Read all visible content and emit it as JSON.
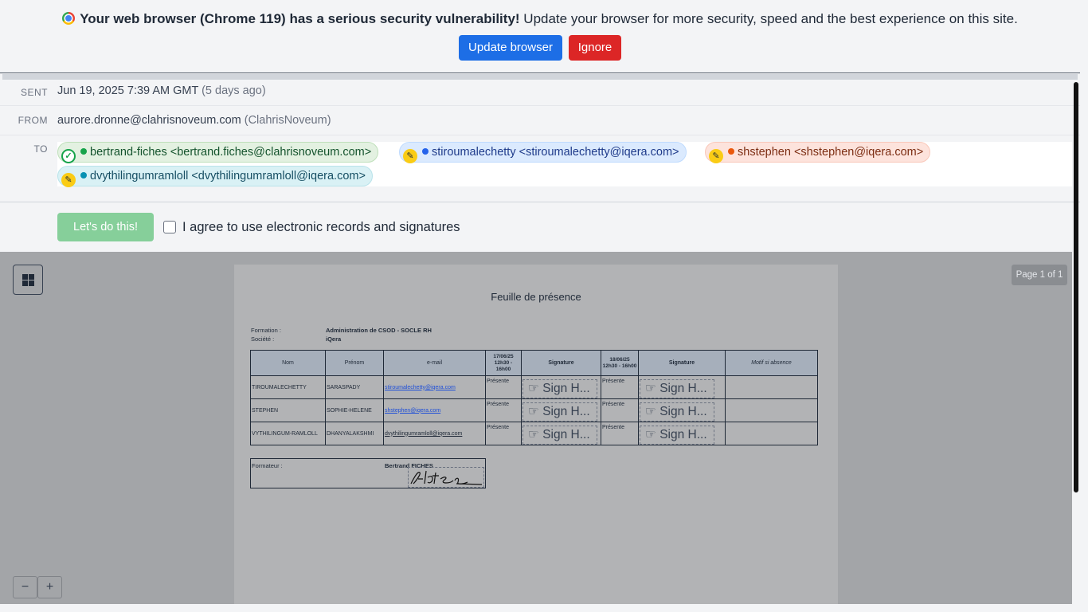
{
  "banner": {
    "icon": "chrome-icon",
    "strong_text": "Your web browser (Chrome 119) has a serious security vulnerability!",
    "text": " Update your browser for more security, speed and the best experience on this site.",
    "update_label": "Update browser",
    "ignore_label": "Ignore",
    "update_color": "#1d6ee6",
    "ignore_color": "#dc2626"
  },
  "message": {
    "sent_label": "SENT",
    "sent_value": "Jun 19, 2025 7:39 AM GMT",
    "sent_relative": "(5 days ago)",
    "from_label": "FROM",
    "from_email": "aurore.dronne@clahrisnoveum.com",
    "from_org": "(ClahrisNoveum)",
    "to_label": "TO",
    "recipients": [
      {
        "label": "bertrand-fiches <bertrand.fiches@clahrisnoveum.com>",
        "status": "signed",
        "dot_color": "#16a34a"
      },
      {
        "label": "stiroumalechetty <stiroumalechetty@iqera.com>",
        "status": "pending",
        "dot_color": "#2563eb"
      },
      {
        "label": "shstephen <shstephen@iqera.com>",
        "status": "pending",
        "dot_color": "#ea580c"
      },
      {
        "label": "dvythilingumramloll <dvythilingumramloll@iqera.com>",
        "status": "pending",
        "dot_color": "#0891b2"
      }
    ]
  },
  "consent": {
    "button_label": "Let's do this!",
    "checkbox_label": "I agree to use electronic records and signatures",
    "checked": false
  },
  "viewer": {
    "page_indicator": "Page 1 of 1",
    "zoom_out": "−",
    "zoom_in": "+"
  },
  "document": {
    "title": "Feuille de présence",
    "formation_label": "Formation :",
    "formation_value": "Administration de CSOD - SOCLE RH",
    "societe_label": "Société :",
    "societe_value": "iQera",
    "headers": [
      "Nom",
      "Prénom",
      "e-mail",
      "17/06/25 12h30 - 16h00",
      "Signature",
      "18/06/25 12h30 - 16h00",
      "Signature",
      "Motif si absence"
    ],
    "rows": [
      {
        "nom": "TIROUMALECHETTY",
        "prenom": "SARASPADY",
        "email": "stiroumalechetty@iqera.com",
        "day1": "Présente",
        "sign1": "Sign H...",
        "day2": "Présente",
        "sign2": "Sign H..."
      },
      {
        "nom": "STEPHEN",
        "prenom": "SOPHIE-HELENE",
        "email": "shstephen@iqera.com",
        "day1": "Présente",
        "sign1": "Sign H...",
        "day2": "Présente",
        "sign2": "Sign H..."
      },
      {
        "nom": "VYTHILINGUM-RAMLOLL",
        "prenom": "DHANYALAKSHMI",
        "email": "dvythilingumramloll@iqera.com",
        "day1": "Présente",
        "sign1": "Sign H...",
        "day2": "Présente",
        "sign2": "Sign H..."
      }
    ],
    "trainer_label": "Formateur :",
    "trainer_name": "Bertrand FICHES"
  }
}
